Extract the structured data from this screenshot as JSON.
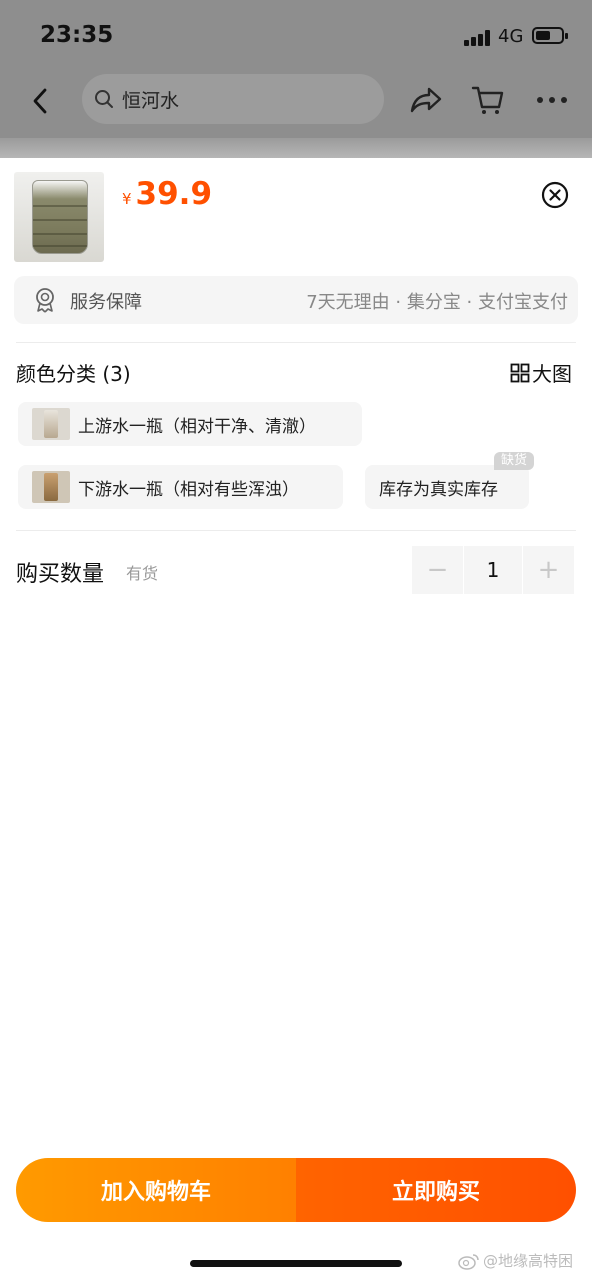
{
  "status_bar": {
    "time": "23:35",
    "network": "4G"
  },
  "header": {
    "search_text": "恒河水"
  },
  "product": {
    "currency": "¥",
    "price": "39.9"
  },
  "service": {
    "label": "服务保障",
    "detail": "7天无理由 · 集分宝 · 支付宝支付"
  },
  "sku": {
    "title": "颜色分类 (3)",
    "big_image_label": "大图",
    "options": [
      {
        "label": "上游水一瓶（相对干净、清澈）"
      },
      {
        "label": "下游水一瓶（相对有些浑浊）"
      },
      {
        "label": "库存为真实库存",
        "badge": "缺货"
      }
    ]
  },
  "quantity": {
    "label": "购买数量",
    "stock": "有货",
    "value": "1",
    "minus": "−",
    "plus": "+"
  },
  "actions": {
    "add_to_cart": "加入购物车",
    "buy_now": "立即购买"
  },
  "watermark": {
    "text": "@地缘高特困"
  },
  "colors": {
    "accent": "#ff5000",
    "cart_orange": "#ff9000",
    "buy_orange": "#ff5000"
  }
}
